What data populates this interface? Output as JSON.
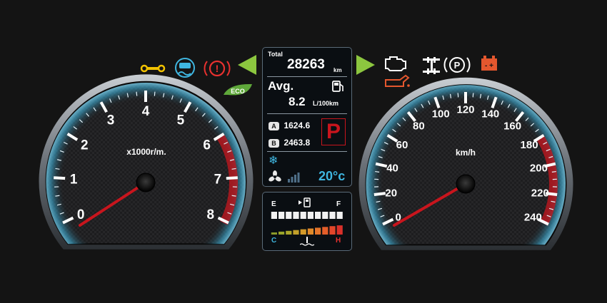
{
  "trip": {
    "total_label": "Total",
    "total_value": "28263",
    "total_unit": "km",
    "avg_label": "Avg.",
    "avg_value": "8.2",
    "avg_unit": "L/100km",
    "trip_a_badge": "A",
    "trip_a_value": "1624.6",
    "trip_b_badge": "B",
    "trip_b_value": "2463.8",
    "gear": "P",
    "temperature": "20°c"
  },
  "tachometer": {
    "unit": "x1000r/m.",
    "ticks": [
      "0",
      "1",
      "2",
      "3",
      "4",
      "5",
      "6",
      "7",
      "8"
    ],
    "min": 0,
    "max": 8,
    "redline": 6,
    "value": 0
  },
  "speedometer": {
    "unit": "km/h",
    "ticks": [
      "0",
      "20",
      "40",
      "60",
      "80",
      "100",
      "120",
      "140",
      "160",
      "180",
      "200",
      "220",
      "240"
    ],
    "min": 0,
    "max": 240,
    "redline": 180,
    "value": 0
  },
  "fuel_gauge": {
    "empty_label": "E",
    "full_label": "F",
    "level_segments": 10,
    "total_segments": 10
  },
  "temp_gauge": {
    "cold_label": "C",
    "hot_label": "H",
    "segments": 10
  },
  "indicators": {
    "left": [
      "wrench-icon",
      "traction-control-icon",
      "brake-warning-icon",
      "eco-icon"
    ],
    "right": [
      "engine-check-icon",
      "oil-pressure-icon",
      "four-wheel-drive-icon",
      "parking-brake-icon",
      "battery-icon"
    ]
  },
  "colors": {
    "accent_blue": "#3fb6e0",
    "needle_red": "#c8151d",
    "turn_signal_green": "#8cc63f",
    "warning_red": "#e8312f",
    "warning_orange": "#e4572e",
    "indicator_yellow": "#f2c200",
    "eco_green": "#5fa83a"
  }
}
